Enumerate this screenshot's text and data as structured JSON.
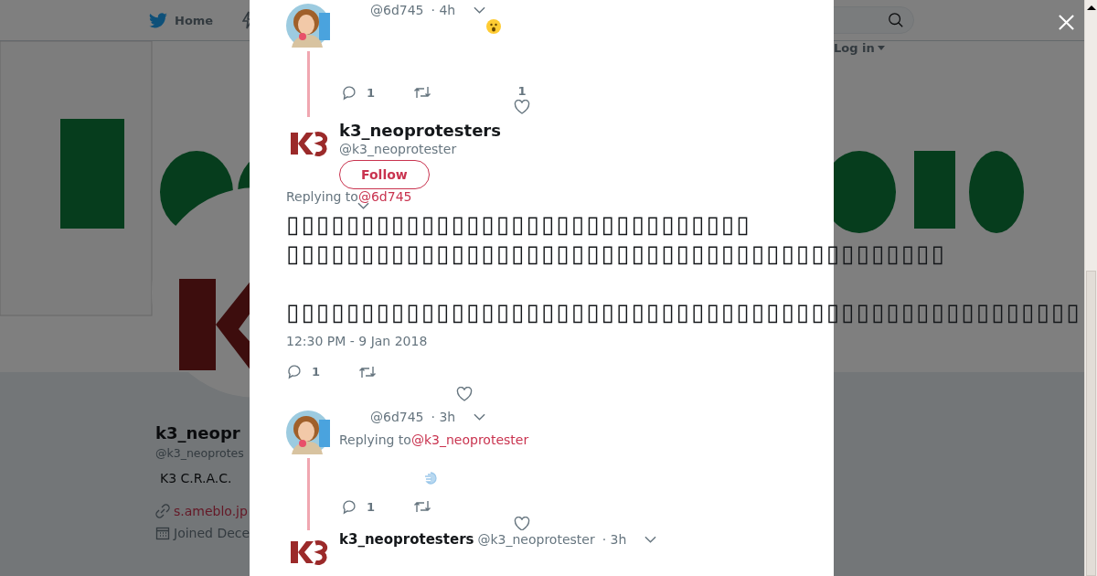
{
  "nav": {
    "home": "Home",
    "login": "Log in"
  },
  "profile": {
    "name": "k3_neopr",
    "handle": "@k3_neoprotes",
    "bio": "K3 C.R.A.C.",
    "link": "s.ameblo.jp",
    "joined": "Joined Dece"
  },
  "tweets": [
    {
      "kind": "reply",
      "handle": "@6d745",
      "time": "· 4h",
      "replies": "1",
      "likes": "1"
    },
    {
      "kind": "focused",
      "name": "k3_neoprotesters",
      "handle": "@k3_neoprotester",
      "follow": "Follow",
      "replying_to": "Replying to",
      "replying_handle": "@6d745",
      "paragraphs": [
        "▯▯▯▯▯▯▯▯▯▯▯▯▯▯▯▯▯▯▯▯▯▯▯▯▯▯▯▯▯▯▯\n▯▯▯▯▯▯▯▯▯▯▯▯▯▯▯▯▯▯▯▯▯▯▯▯▯▯▯▯▯▯▯▯▯▯▯▯▯▯▯▯▯▯▯▯",
        "▯▯▯▯▯▯▯▯▯▯▯▯▯▯▯▯▯▯▯▯▯▯▯▯▯▯▯▯▯▯▯▯▯▯▯▯▯▯▯▯▯▯▯▯▯▯▯▯▯▯▯▯▯"
      ],
      "timestamp": "12:30 PM - 9 Jan 2018",
      "replies": "1"
    },
    {
      "kind": "reply",
      "handle": "@6d745",
      "time": "· 3h",
      "replying_to": "Replying to",
      "replying_handle": "@k3_neoprotester",
      "replies": "1"
    },
    {
      "kind": "header",
      "name": "k3_neoprotesters",
      "handle": "@k3_neoprotester",
      "time": "· 3h"
    }
  ]
}
